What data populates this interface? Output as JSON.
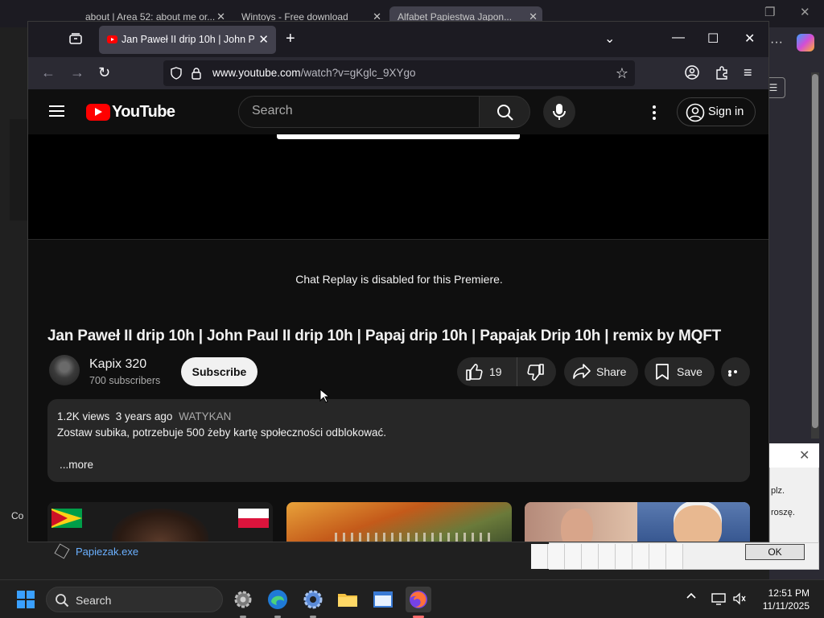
{
  "background_window": {
    "tabs": [
      {
        "label": "about | Area 52: about me or..."
      },
      {
        "label": "Wintoys - Free download"
      },
      {
        "label": "Alfabet Papiestwa Japon..."
      }
    ],
    "left_snippet": "Co",
    "file_item": "Papiezak.exe"
  },
  "dialog": {
    "line1": "plz.",
    "line2": "roszę.",
    "ok_label": "OK"
  },
  "browser": {
    "tab_title": "Jan Paweł II drip 10h | John Paul II drip 10h | Papaj drip 10h",
    "url_domain": "www.youtube.com",
    "url_path": "/watch?v=gKglc_9XYgo"
  },
  "youtube": {
    "wordmark": "YouTube",
    "search_placeholder": "Search",
    "signin_label": "Sign in",
    "chat_message": "Chat Replay is disabled for this Premiere.",
    "video_title": "Jan Paweł II drip 10h | John Paul II drip 10h | Papaj drip 10h | Papajak Drip 10h | remix by MQFT",
    "channel_name": "Kapix 320",
    "subscribers": "700 subscribers",
    "subscribe_label": "Subscribe",
    "like_count": "19",
    "share_label": "Share",
    "save_label": "Save",
    "description": {
      "views": "1.2K views",
      "age": "3 years ago",
      "tag": "WATYKAN",
      "text": "Zostaw subika, potrzebuje 500 żeby kartę społeczności odblokować.",
      "more_label": "...more"
    }
  },
  "taskbar": {
    "search_label": "Search",
    "time": "12:51 PM",
    "date": "11/11/2025"
  }
}
